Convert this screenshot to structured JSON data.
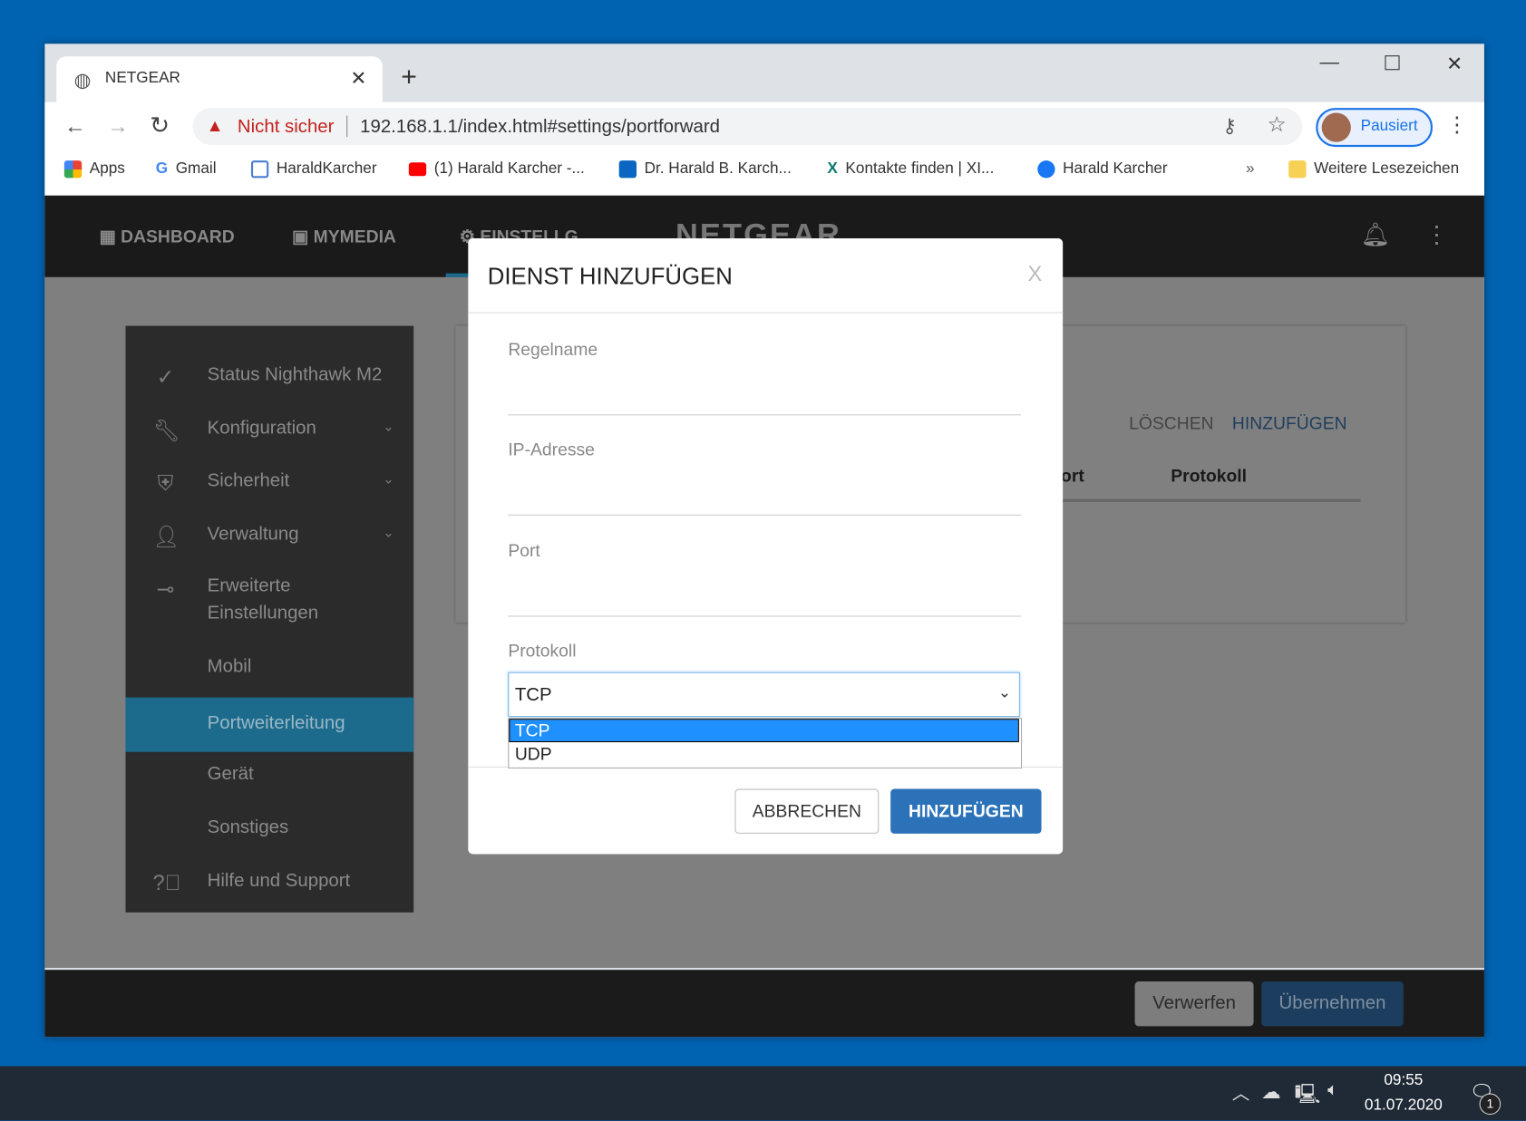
{
  "browser": {
    "tab_title": "NETGEAR",
    "security": "Nicht sicher",
    "url": "192.168.1.1/index.html#settings/portforward",
    "profile": "Pausiert",
    "bookmarks": [
      "Apps",
      "Gmail",
      "HaraldKarcher",
      "(1) Harald Karcher -...",
      "Dr. Harald B. Karch...",
      "Kontakte finden | XI...",
      "Harald Karcher"
    ],
    "overflow": "»",
    "other_bookmarks": "Weitere Lesezeichen"
  },
  "nav": {
    "dashboard": "DASHBOARD",
    "mymedia": "MYMEDIA",
    "settings": "EINSTELLG",
    "logo": "NETGEAR"
  },
  "sidebar": {
    "items": [
      {
        "label": "Status Nighthawk M2"
      },
      {
        "label": "Konfiguration"
      },
      {
        "label": "Sicherheit"
      },
      {
        "label": "Verwaltung"
      },
      {
        "label": "Erweiterte Einstellungen"
      },
      {
        "label": "Mobil"
      },
      {
        "label": "Portweiterleitung"
      },
      {
        "label": "Gerät"
      },
      {
        "label": "Sonstiges"
      },
      {
        "label": "Hilfe und Support"
      }
    ]
  },
  "card": {
    "delete": "LÖSCHEN",
    "add": "HINZUFÜGEN",
    "col_port": "Port",
    "col_protocol": "Protokoll"
  },
  "modal": {
    "title": "DIENST HINZUFÜGEN",
    "close": "X",
    "rule_name": "Regelname",
    "ip": "IP-Adresse",
    "port": "Port",
    "protocol": "Protokoll",
    "protocol_value": "TCP",
    "options": [
      "TCP",
      "UDP"
    ],
    "cancel": "ABBRECHEN",
    "submit": "HINZUFÜGEN"
  },
  "footer": {
    "discard": "Verwerfen",
    "apply": "Übernehmen"
  },
  "taskbar": {
    "time": "09:55",
    "date": "01.07.2020",
    "notifications": "1"
  }
}
